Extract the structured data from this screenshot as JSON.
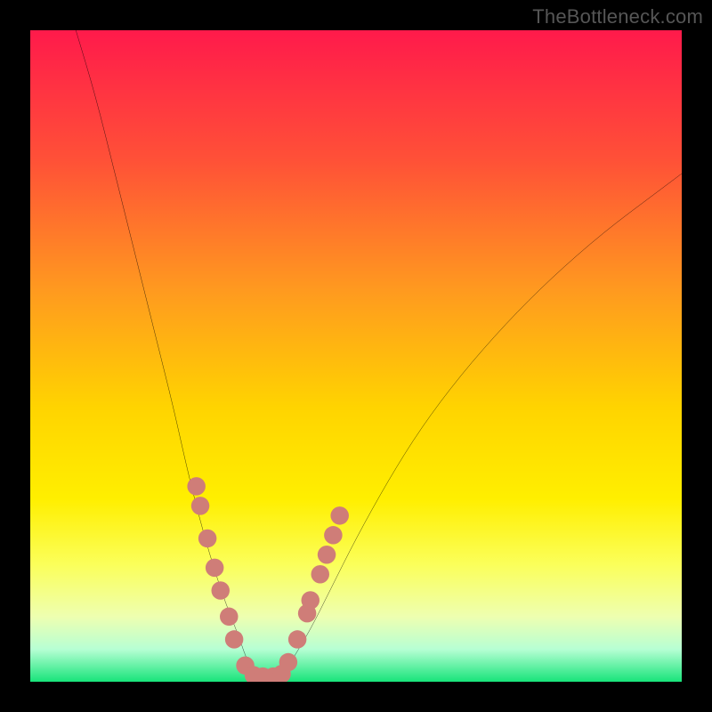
{
  "watermark": "TheBottleneck.com",
  "colors": {
    "frame": "#000000",
    "curve": "#000000",
    "marker_fill": "#cf7d78",
    "gradient_stops": [
      {
        "offset": 0.0,
        "color": "#ff1a4b"
      },
      {
        "offset": 0.2,
        "color": "#ff5137"
      },
      {
        "offset": 0.4,
        "color": "#ff9a1f"
      },
      {
        "offset": 0.58,
        "color": "#ffd400"
      },
      {
        "offset": 0.72,
        "color": "#ffef00"
      },
      {
        "offset": 0.82,
        "color": "#fbff5a"
      },
      {
        "offset": 0.9,
        "color": "#eeffb0"
      },
      {
        "offset": 0.95,
        "color": "#b7ffd4"
      },
      {
        "offset": 1.0,
        "color": "#18e47a"
      }
    ]
  },
  "chart_data": {
    "type": "line",
    "title": "",
    "xlabel": "",
    "ylabel": "",
    "xlim": [
      0,
      100
    ],
    "ylim": [
      0,
      100
    ],
    "series": [
      {
        "name": "left-curve",
        "x": [
          7,
          10,
          13,
          16,
          19,
          22,
          24,
          26,
          28,
          30,
          32,
          33,
          34,
          35
        ],
        "y": [
          100,
          90,
          78,
          66,
          54,
          42,
          33,
          25,
          18,
          12,
          7,
          4,
          2,
          0.5
        ]
      },
      {
        "name": "right-curve",
        "x": [
          38,
          40,
          43,
          46,
          50,
          55,
          60,
          66,
          73,
          80,
          88,
          96,
          100
        ],
        "y": [
          0.5,
          3,
          8,
          14,
          22,
          31,
          39,
          47,
          55,
          62,
          69,
          75,
          78
        ]
      }
    ],
    "markers": [
      {
        "x": 25.5,
        "y": 30
      },
      {
        "x": 26.1,
        "y": 27
      },
      {
        "x": 27.2,
        "y": 22
      },
      {
        "x": 28.3,
        "y": 17.5
      },
      {
        "x": 29.2,
        "y": 14
      },
      {
        "x": 30.5,
        "y": 10
      },
      {
        "x": 31.3,
        "y": 6.5
      },
      {
        "x": 33.0,
        "y": 2.5
      },
      {
        "x": 34.3,
        "y": 1.0
      },
      {
        "x": 35.7,
        "y": 0.8
      },
      {
        "x": 37.3,
        "y": 0.8
      },
      {
        "x": 38.6,
        "y": 1.2
      },
      {
        "x": 39.6,
        "y": 3.0
      },
      {
        "x": 41.0,
        "y": 6.5
      },
      {
        "x": 42.5,
        "y": 10.5
      },
      {
        "x": 43.0,
        "y": 12.5
      },
      {
        "x": 44.5,
        "y": 16.5
      },
      {
        "x": 45.5,
        "y": 19.5
      },
      {
        "x": 46.5,
        "y": 22.5
      },
      {
        "x": 47.5,
        "y": 25.5
      }
    ],
    "marker_radius": 1.4
  }
}
